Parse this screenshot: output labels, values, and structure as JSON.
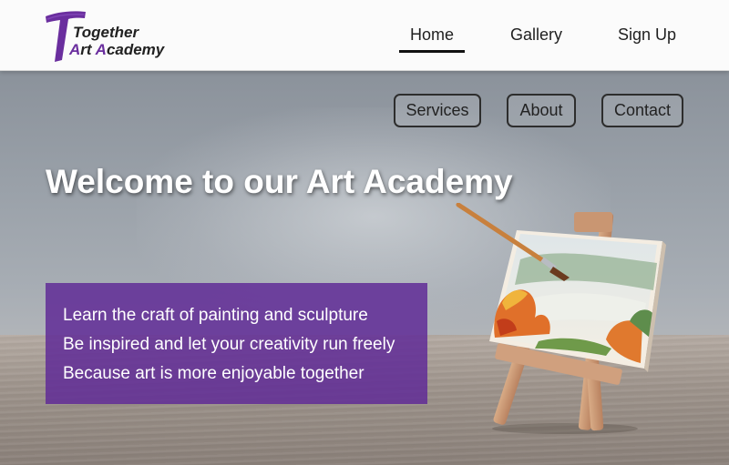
{
  "header": {
    "logo": {
      "line1": "Together",
      "line2_a": "A",
      "line2_rt": "rt ",
      "line2_A": "A",
      "line2_cademy": "cademy"
    },
    "nav": {
      "home": "Home",
      "gallery": "Gallery",
      "signup": "Sign Up"
    }
  },
  "hero": {
    "buttons": {
      "services": "Services",
      "about": "About",
      "contact": "Contact"
    },
    "title": "Welcome to our Art Academy",
    "lines": [
      "Learn the craft of painting and sculpture",
      "Be inspired and let your creativity run freely",
      "Because art is more enjoyable together"
    ]
  },
  "colors": {
    "accent": "#6a2e9e",
    "info_box": "#602c96",
    "header_bg": "#fbfbfb"
  },
  "icons": {
    "logo_mark": "brush-t-logo-icon",
    "easel": "easel-with-painting-icon"
  }
}
